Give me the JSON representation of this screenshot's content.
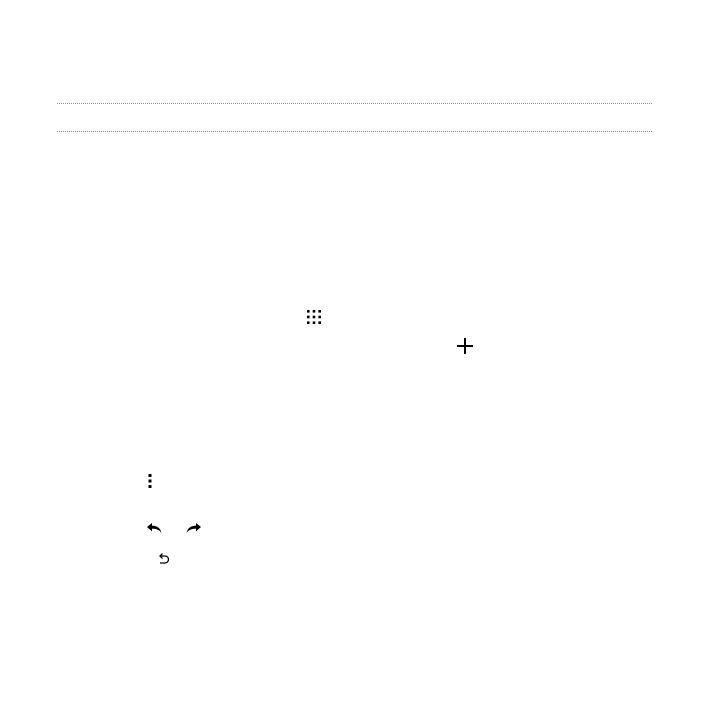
{
  "page": {
    "background": "#ffffff",
    "rule_color": "#8c8c8c",
    "icon_color": "#000000"
  },
  "icons": [
    "apps-grid-icon",
    "plus-icon",
    "more-menu-icon",
    "undo-icon",
    "redo-icon",
    "back-return-icon"
  ]
}
